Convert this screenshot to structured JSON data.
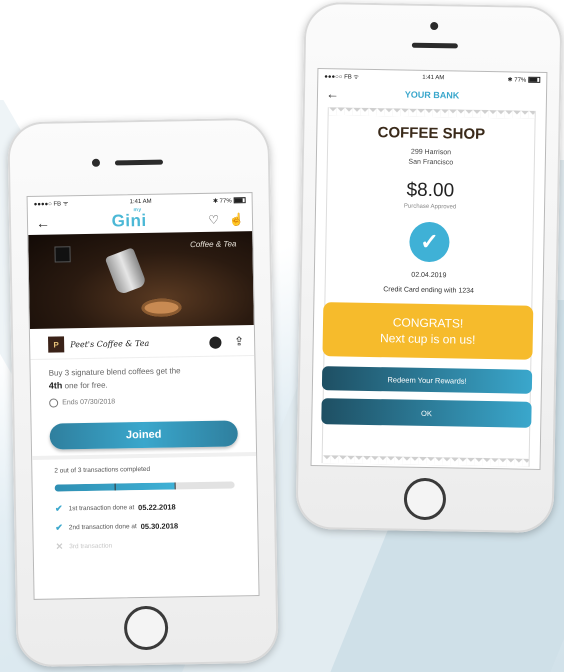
{
  "left_phone": {
    "status": {
      "carrier": "●●●●○ FB ᯤ",
      "time": "1:41 AM",
      "battery": "✱ 77%"
    },
    "nav": {
      "back_icon": "back-arrow-icon",
      "logo": "Gini",
      "logo_small": "my"
    },
    "hero": {
      "sign_text": "Coffee & Tea"
    },
    "merchant": {
      "logo_text": "P",
      "name": "Peet's Coffee & Tea"
    },
    "offer": {
      "text_before": "Buy 3 signature blend coffees get the",
      "highlight": "4th",
      "text_after": "one for free."
    },
    "ends": "Ends 07/30/2018",
    "joined_label": "Joined",
    "progress": {
      "text": "2 out of 3 transactions completed",
      "completed": 2,
      "total": 3
    },
    "transactions": [
      {
        "label": "1st transaction done at",
        "date": "05.22.2018",
        "done": true
      },
      {
        "label": "2nd transaction done at",
        "date": "05.30.2018",
        "done": true
      },
      {
        "label": "3rd transaction",
        "date": "",
        "done": false
      }
    ]
  },
  "right_phone": {
    "status": {
      "carrier": "●●●○○ FB ᯤ",
      "time": "1:41 AM",
      "battery": "✱ 77%"
    },
    "nav": {
      "title": "YOUR BANK"
    },
    "receipt": {
      "shop": "COFFEE SHOP",
      "address_line1": "299 Harrison",
      "address_line2": "San Francisco",
      "amount": "$8.00",
      "status": "Purchase Approved",
      "date": "02.04.2019",
      "card": "Credit Card ending with 1234"
    },
    "congrats_line1": "CONGRATS!",
    "congrats_line2": "Next cup is on us!",
    "redeem_label": "Redeem Your Rewards!",
    "ok_label": "OK"
  },
  "colors": {
    "accent": "#3aa7cc",
    "congrats": "#f6bb2c"
  }
}
